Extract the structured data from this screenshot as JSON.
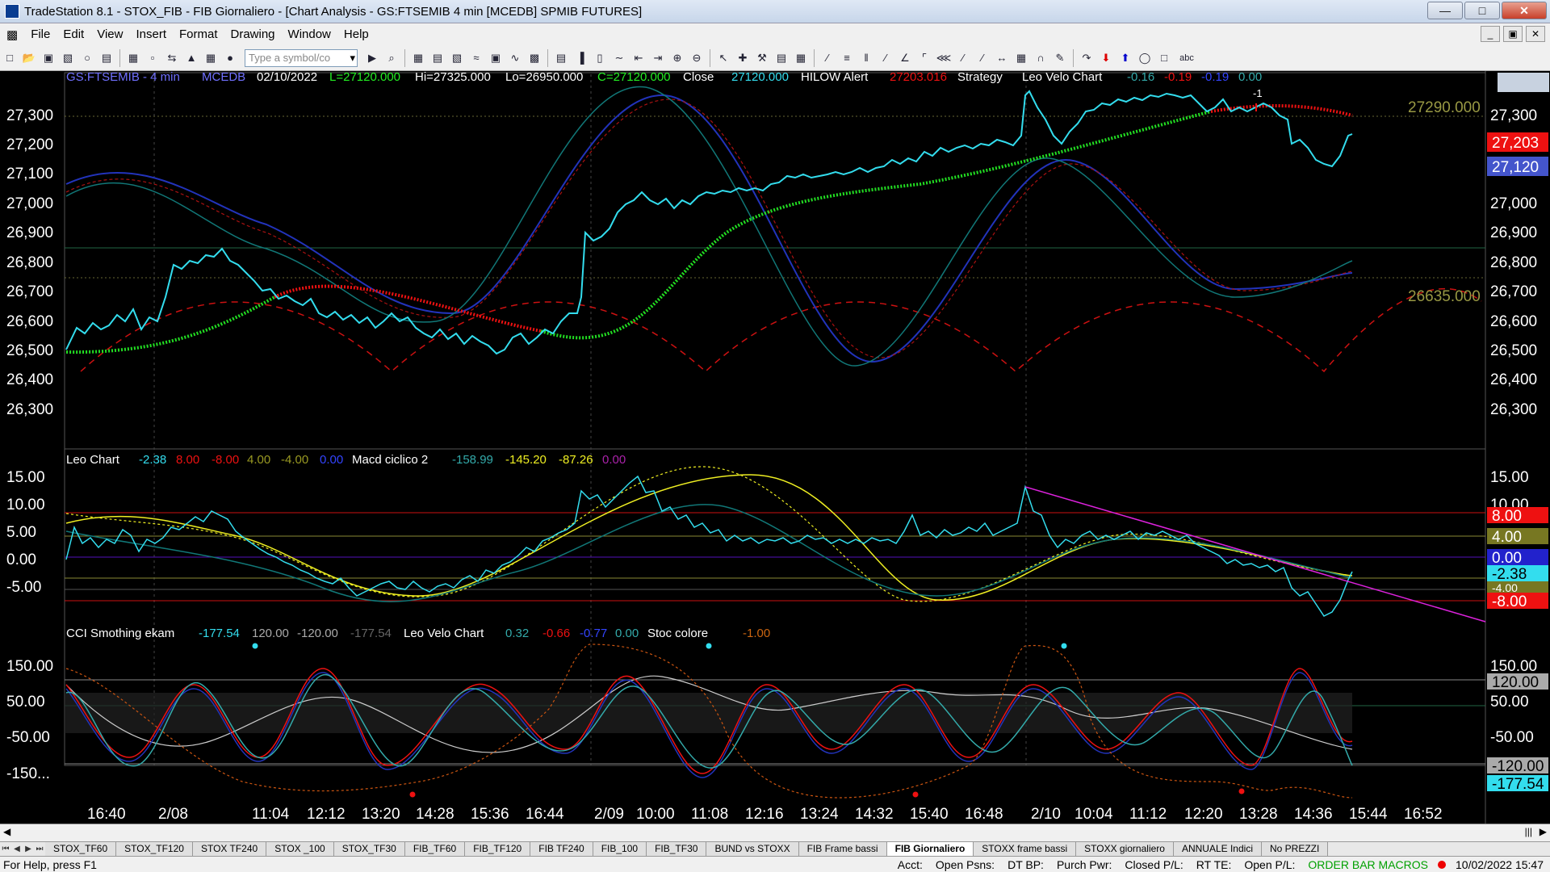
{
  "window": {
    "title": "TradeStation 8.1 - STOX_FIB - FIB Giornaliero - [Chart Analysis - GS:FTSEMIB  4 min  [MCEDB] SPMIB FUTURES]"
  },
  "menu": [
    "File",
    "Edit",
    "View",
    "Insert",
    "Format",
    "Drawing",
    "Window",
    "Help"
  ],
  "toolbar": {
    "symbol_placeholder": "Type a symbol/co",
    "abc_label": "abc"
  },
  "header": {
    "symbol": "GS:FTSEMIB - 4 min",
    "exchange": "MCEDB",
    "date": "02/10/2022",
    "low_close": "L=27120.000",
    "hi": "Hi=27325.000",
    "lo": "Lo=26950.000",
    "close": "C=27120.000",
    "close_label": "Close",
    "close_value": "27120.000",
    "hilow_label": "HILOW Alert",
    "hilow_value": "27203.016",
    "strategy_label": "Strategy",
    "leovelo_label": "Leo Velo Chart",
    "leovelo_v1": "-0.16",
    "leovelo_v2": "-0.19",
    "leovelo_v3": "-0.19",
    "leovelo_v4": "0.00"
  },
  "panel2_header": {
    "leo_label": "Leo Chart",
    "v1": "-2.38",
    "v2": "8.00",
    "v3": "-8.00",
    "v4": "4.00",
    "v5": "-4.00",
    "v6": "0.00",
    "macd_label": "Macd ciclico 2",
    "m1": "-158.99",
    "m2": "-145.20",
    "m3": "-87.26",
    "m4": "0.00"
  },
  "panel3_header": {
    "cci_label": "CCI Smothing ekam",
    "c1": "-177.54",
    "c2": "120.00",
    "c3": "-120.00",
    "c4": "-177.54",
    "leovelo_label": "Leo Velo Chart",
    "l1": "0.32",
    "l2": "-0.66",
    "l3": "-0.77",
    "l4": "0.00",
    "stoc_label": "Stoc colore",
    "s1": "-1.00"
  },
  "price_axis": {
    "ticks": [
      "27,300",
      "27,200",
      "27,100",
      "27,000",
      "26,900",
      "26,800",
      "26,700",
      "26,600",
      "26,500",
      "26,400",
      "26,300"
    ],
    "levels": [
      "27290.000",
      "26635.000"
    ],
    "tags": {
      "red": "27,203",
      "blue": "27,120"
    },
    "marker": "-1"
  },
  "panel2_axis": {
    "ticks": [
      "15.00",
      "10.00",
      "5.00",
      "0.00",
      "-5.00"
    ],
    "right_ticks": [
      "15.00",
      "10.00"
    ],
    "tags": [
      "8.00",
      "4.00",
      "0.00",
      "-2.38",
      "-4.00",
      "-8.00"
    ]
  },
  "panel3_axis": {
    "ticks": [
      "150.00",
      "50.00",
      "-50.00",
      "-150..."
    ],
    "right_ticks": [
      "150.00",
      "50.00",
      "-50.00"
    ],
    "tags": [
      "120.00",
      "-120.00",
      "-177.54"
    ]
  },
  "time_axis": [
    "16:40",
    "2/08",
    "11:04",
    "12:12",
    "13:20",
    "14:28",
    "15:36",
    "16:44",
    "2/09",
    "10:00",
    "11:08",
    "12:16",
    "13:24",
    "14:32",
    "15:40",
    "16:48",
    "2/10",
    "10:04",
    "11:12",
    "12:20",
    "13:28",
    "14:36",
    "15:44",
    "16:52"
  ],
  "tabs": [
    "STOX_TF60",
    "STOX_TF120",
    "STOX TF240",
    "STOX _100",
    "STOX_TF30",
    "FIB_TF60",
    "FIB_TF120",
    "FIB TF240",
    "FIB_100",
    "FIB_TF30",
    "BUND vs STOXX",
    "FIB Frame bassi",
    "FIB Giornaliero",
    "STOXX frame bassi",
    "STOXX giornaliero",
    "ANNUALE Indici",
    "No PREZZI"
  ],
  "active_tab": "FIB Giornaliero",
  "status": {
    "help": "For Help, press F1",
    "acct": "Acct:",
    "open_psns": "Open Psns:",
    "dt_bp": "DT BP:",
    "purch_pwr": "Purch Pwr:",
    "closed_pl": "Closed P/L:",
    "rt_te": "RT TE:",
    "open_pl": "Open P/L:",
    "order_bar": "ORDER BAR  MACROS",
    "datetime": "10/02/2022 15:47"
  },
  "colors": {
    "price": "#33ddee",
    "ma_green": "#22dd22",
    "ma_red": "#ee1111",
    "navy": "#2233bb",
    "teal": "#117777",
    "yellow": "#eeee22",
    "magenta": "#dd22dd"
  }
}
